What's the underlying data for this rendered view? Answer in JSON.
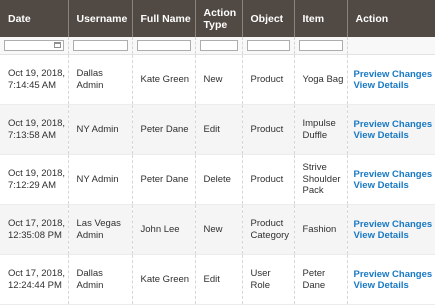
{
  "columns": [
    "Date",
    "Username",
    "Full Name",
    "Action Type",
    "Object",
    "Item",
    "Action"
  ],
  "rows": [
    {
      "date": "Oct 19, 2018, 7:14:45 AM",
      "username": "Dallas Admin",
      "full_name": "Kate Green",
      "action_type": "New",
      "object": "Product",
      "item": "Yoga Bag"
    },
    {
      "date": "Oct 19, 2018, 7:13:58 AM",
      "username": "NY Admin",
      "full_name": "Peter Dane",
      "action_type": "Edit",
      "object": "Product",
      "item": "Impulse Duffle"
    },
    {
      "date": "Oct 19, 2018, 7:12:29 AM",
      "username": "NY Admin",
      "full_name": "Peter Dane",
      "action_type": "Delete",
      "object": "Product",
      "item": "Strive Shoulder Pack"
    },
    {
      "date": "Oct 17, 2018, 12:35:08 PM",
      "username": "Las Vegas Admin",
      "full_name": "John Lee",
      "action_type": "New",
      "object": "Product Category",
      "item": "Fashion"
    },
    {
      "date": "Oct 17, 2018, 12:24:44 PM",
      "username": "Dallas Admin",
      "full_name": "Kate Green",
      "action_type": "Edit",
      "object": "User Role",
      "item": "Peter Dane"
    }
  ],
  "actions": {
    "preview": "Preview Changes",
    "details": "View Details"
  },
  "colors": {
    "header_bg": "#514943",
    "link": "#1979c3",
    "row_alt": "#f5f5f5"
  },
  "icons": {
    "date_filter": "calendar-icon"
  }
}
